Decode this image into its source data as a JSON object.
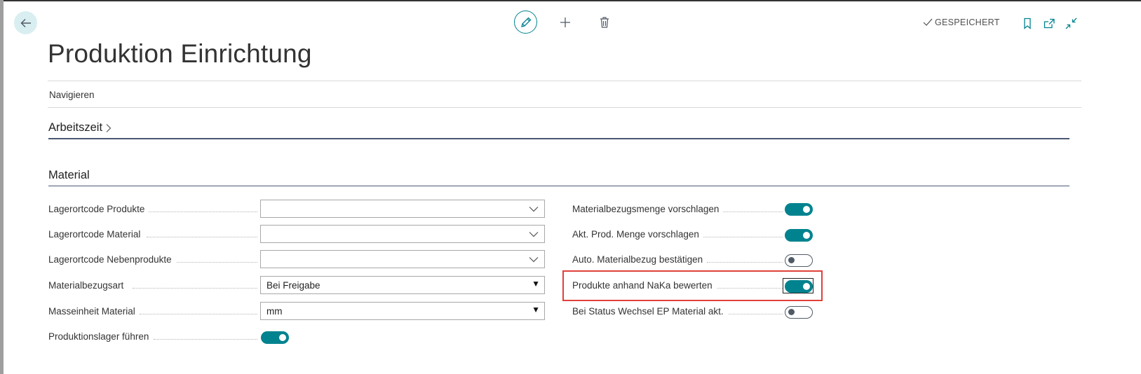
{
  "header": {
    "saved_label": "GESPEICHERT",
    "icons": [
      "back-arrow-icon",
      "edit-pencil-icon",
      "plus-icon",
      "trash-icon",
      "checkmark-icon",
      "bookmark-icon",
      "open-new-window-icon",
      "collapse-icon"
    ]
  },
  "page": {
    "title": "Produktion Einrichtung",
    "nav_label": "Navigieren"
  },
  "sections": {
    "arbeitszeit": {
      "title": "Arbeitszeit"
    },
    "material": {
      "title": "Material"
    }
  },
  "left_fields": [
    {
      "label": "Lagerortcode Produkte",
      "value": ""
    },
    {
      "label": "Lagerortcode Material",
      "value": ""
    },
    {
      "label": "Lagerortcode Nebenprodukte",
      "value": ""
    },
    {
      "label": "Materialbezugsart",
      "value": "Bei Freigabe"
    },
    {
      "label": "Masseinheit Material",
      "value": "mm"
    },
    {
      "label": "Produktionslager führen",
      "value": "on"
    }
  ],
  "right_fields": [
    {
      "label": "Materialbezugsmenge vorschlagen",
      "value": "on"
    },
    {
      "label": "Akt. Prod. Menge vorschlagen",
      "value": "on"
    },
    {
      "label": "Auto. Materialbezug bestätigen",
      "value": "off"
    },
    {
      "label": "Produkte anhand NaKa bewerten",
      "value": "on"
    },
    {
      "label": "Bei Status Wechsel EP Material akt.",
      "value": "off"
    }
  ],
  "colors": {
    "accent": "#00838f",
    "highlight": "#e0413a",
    "section_line": "#4a5873"
  }
}
